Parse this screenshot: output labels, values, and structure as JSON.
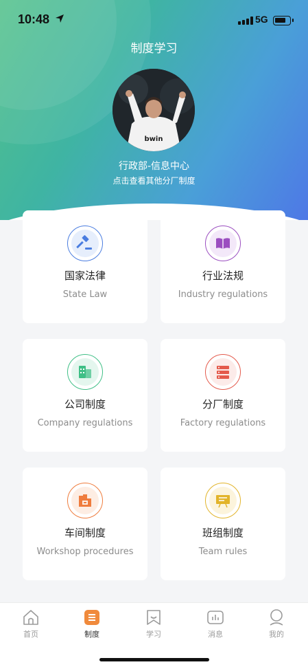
{
  "status_bar": {
    "time": "10:48",
    "network": "5G",
    "battery_level": 0.8
  },
  "header": {
    "title": "制度学习"
  },
  "profile": {
    "department": "行政部-信息中心",
    "hint": "点击查看其他分厂制度"
  },
  "cards": [
    {
      "title": "国家法律",
      "subtitle": "State Law",
      "icon": "gavel-icon",
      "color": "#4a7de0"
    },
    {
      "title": "行业法规",
      "subtitle": "Industry regulations",
      "icon": "book-icon",
      "color": "#9b4ec0"
    },
    {
      "title": "公司制度",
      "subtitle": "Company regulations",
      "icon": "building-icon",
      "color": "#3fbf86"
    },
    {
      "title": "分厂制度",
      "subtitle": "Factory regulations",
      "icon": "server-icon",
      "color": "#e45a4c"
    },
    {
      "title": "车间制度",
      "subtitle": "Workshop procedures",
      "icon": "factory-icon",
      "color": "#ef7c3d"
    },
    {
      "title": "班组制度",
      "subtitle": "Team rules",
      "icon": "presentation-icon",
      "color": "#e2b42a"
    }
  ],
  "tabs": [
    {
      "label": "首页",
      "icon": "home-icon"
    },
    {
      "label": "制度",
      "icon": "rules-icon",
      "active": true
    },
    {
      "label": "学习",
      "icon": "bookmark-icon"
    },
    {
      "label": "消息",
      "icon": "chart-icon"
    },
    {
      "label": "我的",
      "icon": "user-icon"
    }
  ]
}
